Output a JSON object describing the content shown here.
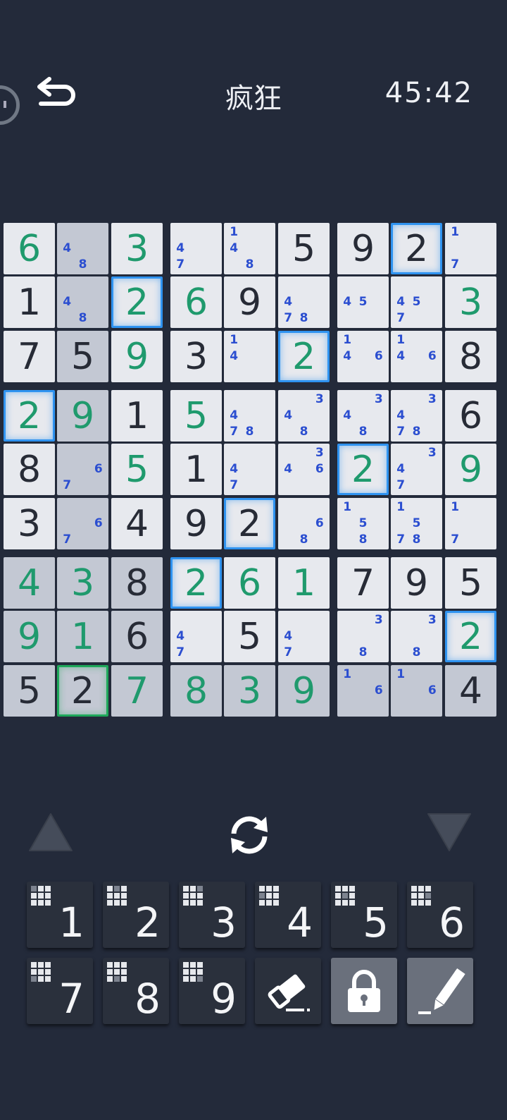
{
  "header": {
    "title": "疯狂",
    "timer": "45:42"
  },
  "board": {
    "cells": [
      [
        {
          "v": "6",
          "t": "user"
        },
        {
          "n": [
            4,
            8
          ]
        },
        {
          "v": "3",
          "t": "user"
        },
        {
          "n": [
            4,
            7
          ]
        },
        {
          "n": [
            1,
            4,
            8
          ]
        },
        {
          "v": "5",
          "t": "given"
        },
        {
          "v": "9",
          "t": "given"
        },
        {
          "v": "2",
          "t": "given"
        },
        {
          "n": [
            1,
            7
          ]
        }
      ],
      [
        {
          "v": "1",
          "t": "given"
        },
        {
          "n": [
            4,
            8
          ]
        },
        {
          "v": "2",
          "t": "user"
        },
        {
          "v": "6",
          "t": "user"
        },
        {
          "v": "9",
          "t": "given"
        },
        {
          "n": [
            4,
            7,
            8
          ]
        },
        {
          "n": [
            4,
            5
          ]
        },
        {
          "n": [
            4,
            5,
            7
          ]
        },
        {
          "v": "3",
          "t": "user"
        }
      ],
      [
        {
          "v": "7",
          "t": "given"
        },
        {
          "v": "5",
          "t": "given"
        },
        {
          "v": "9",
          "t": "user"
        },
        {
          "v": "3",
          "t": "given"
        },
        {
          "n": [
            1,
            4
          ]
        },
        {
          "v": "2",
          "t": "user"
        },
        {
          "n": [
            1,
            4,
            6
          ]
        },
        {
          "n": [
            1,
            4,
            6
          ]
        },
        {
          "v": "8",
          "t": "given"
        }
      ],
      [
        {
          "v": "2",
          "t": "user"
        },
        {
          "v": "9",
          "t": "user"
        },
        {
          "v": "1",
          "t": "given"
        },
        {
          "v": "5",
          "t": "user"
        },
        {
          "n": [
            4,
            7,
            8
          ]
        },
        {
          "n": [
            3,
            4,
            8
          ]
        },
        {
          "n": [
            3,
            4,
            8
          ]
        },
        {
          "n": [
            3,
            4,
            7,
            8
          ]
        },
        {
          "v": "6",
          "t": "given"
        }
      ],
      [
        {
          "v": "8",
          "t": "given"
        },
        {
          "n": [
            6,
            7
          ]
        },
        {
          "v": "5",
          "t": "user"
        },
        {
          "v": "1",
          "t": "given"
        },
        {
          "n": [
            4,
            7
          ]
        },
        {
          "n": [
            3,
            4,
            6
          ]
        },
        {
          "v": "2",
          "t": "user"
        },
        {
          "n": [
            3,
            4,
            7
          ]
        },
        {
          "v": "9",
          "t": "user"
        }
      ],
      [
        {
          "v": "3",
          "t": "given"
        },
        {
          "n": [
            6,
            7
          ]
        },
        {
          "v": "4",
          "t": "given"
        },
        {
          "v": "9",
          "t": "given"
        },
        {
          "v": "2",
          "t": "given"
        },
        {
          "n": [
            6,
            8
          ]
        },
        {
          "n": [
            1,
            5,
            8
          ]
        },
        {
          "n": [
            1,
            5,
            7,
            8
          ]
        },
        {
          "n": [
            1,
            7
          ]
        }
      ],
      [
        {
          "v": "4",
          "t": "user"
        },
        {
          "v": "3",
          "t": "user"
        },
        {
          "v": "8",
          "t": "given"
        },
        {
          "v": "2",
          "t": "user"
        },
        {
          "v": "6",
          "t": "user"
        },
        {
          "v": "1",
          "t": "user"
        },
        {
          "v": "7",
          "t": "given"
        },
        {
          "v": "9",
          "t": "given"
        },
        {
          "v": "5",
          "t": "given"
        }
      ],
      [
        {
          "v": "9",
          "t": "user"
        },
        {
          "v": "1",
          "t": "user"
        },
        {
          "v": "6",
          "t": "given"
        },
        {
          "n": [
            4,
            7
          ]
        },
        {
          "v": "5",
          "t": "given"
        },
        {
          "n": [
            4,
            7
          ]
        },
        {
          "n": [
            3,
            8
          ]
        },
        {
          "n": [
            3,
            8
          ]
        },
        {
          "v": "2",
          "t": "user"
        }
      ],
      [
        {
          "v": "5",
          "t": "given"
        },
        {
          "v": "2",
          "t": "given"
        },
        {
          "v": "7",
          "t": "user"
        },
        {
          "v": "8",
          "t": "user"
        },
        {
          "v": "3",
          "t": "user"
        },
        {
          "v": "9",
          "t": "user"
        },
        {
          "n": [
            1,
            6
          ]
        },
        {
          "n": [
            1,
            6
          ]
        },
        {
          "v": "4",
          "t": "given"
        }
      ]
    ],
    "shaded": [
      [
        0,
        1
      ],
      [
        1,
        1
      ],
      [
        2,
        1
      ],
      [
        3,
        1
      ],
      [
        4,
        1
      ],
      [
        5,
        1
      ],
      [
        6,
        0
      ],
      [
        6,
        1
      ],
      [
        6,
        2
      ],
      [
        7,
        0
      ],
      [
        7,
        1
      ],
      [
        7,
        2
      ],
      [
        8,
        0
      ],
      [
        8,
        1
      ],
      [
        8,
        2
      ],
      [
        8,
        3
      ],
      [
        8,
        4
      ],
      [
        8,
        5
      ],
      [
        8,
        6
      ],
      [
        8,
        7
      ],
      [
        8,
        8
      ]
    ],
    "highlighted": [
      [
        0,
        7
      ],
      [
        1,
        2
      ],
      [
        2,
        5
      ],
      [
        3,
        0
      ],
      [
        4,
        6
      ],
      [
        5,
        4
      ],
      [
        6,
        3
      ],
      [
        7,
        8
      ]
    ],
    "selected": [
      8,
      1
    ]
  },
  "controls": {
    "up_icon": "triangle-up-icon",
    "refresh_icon": "refresh-icon",
    "down_icon": "triangle-down-icon"
  },
  "keypad": {
    "numbers": [
      "1",
      "2",
      "3",
      "4",
      "5",
      "6",
      "7",
      "8",
      "9"
    ],
    "tools": [
      "eraser-icon",
      "lock-icon",
      "pencil-icon"
    ]
  },
  "colors": {
    "background": "#232a3a",
    "given_digit": "#272b36",
    "user_digit": "#1f9a6d",
    "note_digit": "#2b4ed0",
    "highlight": "#2f93f0",
    "selected": "#1ea85a"
  }
}
